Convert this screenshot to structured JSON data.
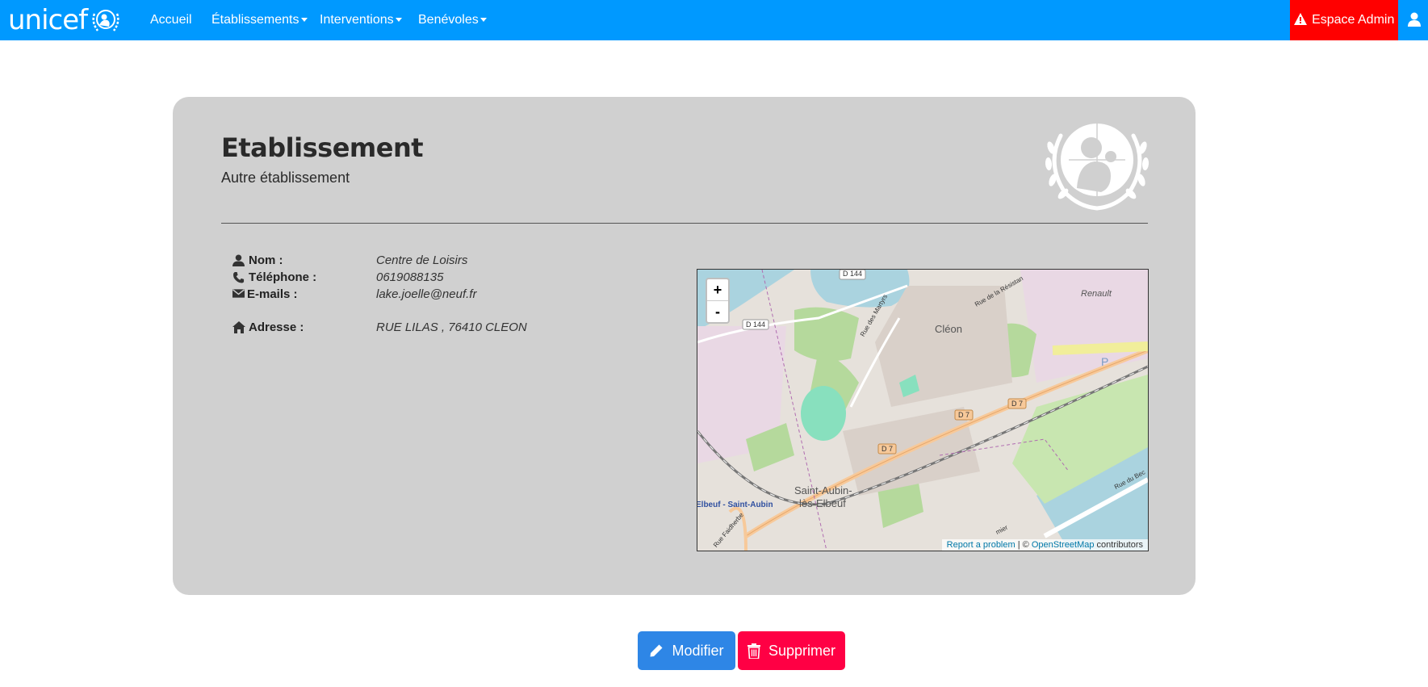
{
  "nav": {
    "brand": "unicef",
    "items": [
      {
        "label": "Accueil",
        "dropdown": false
      },
      {
        "label": "Établissements",
        "dropdown": true
      },
      {
        "label": "Interventions",
        "dropdown": true
      },
      {
        "label": "Benévoles",
        "dropdown": true
      }
    ],
    "admin_label": "Espace Admin"
  },
  "panel": {
    "title": "Etablissement",
    "subtitle": "Autre établissement"
  },
  "info": {
    "name_label": "Nom :",
    "name_value": "Centre de Loisirs",
    "phone_label": "Téléphone :",
    "phone_value": "0619088135",
    "email_label": "E-mails :",
    "email_value": "lake.joelle@neuf.fr",
    "address_label": "Adresse :",
    "address_value": "RUE LILAS , 76410 CLEON"
  },
  "map": {
    "zoom_in": "+",
    "zoom_out": "-",
    "report": "Report a problem",
    "separator": " | © ",
    "osm": "OpenStreetMap",
    "contributors": " contributors",
    "labels": {
      "d144_top": "D 144",
      "d144_left": "D 144",
      "d7_a": "D 7",
      "d7_b": "D 7",
      "d7_c": "D 7",
      "cleon": "Cléon",
      "renault": "Renault",
      "saint_aubin_1": "Saint-Aubin-",
      "saint_aubin_2": "lès-Elbeuf",
      "station": "Elbeuf - Saint-Aubin",
      "rue_martyrs": "Rue des Martyrs",
      "rue_resistance": "Rue de la Résistan",
      "rue_faidherbe": "Rue Faidherbe",
      "rue_du_bec": "Rue du Bec",
      "rue_mier": "mier",
      "parking": "P"
    }
  },
  "actions": {
    "edit_label": "Modifier",
    "delete_label": "Supprimer"
  },
  "colors": {
    "navbar": "#0099ff",
    "admin": "#ff0000",
    "panel": "#d0d0d0",
    "edit_button": "#2e86e6",
    "delete_button": "#ff0044"
  }
}
